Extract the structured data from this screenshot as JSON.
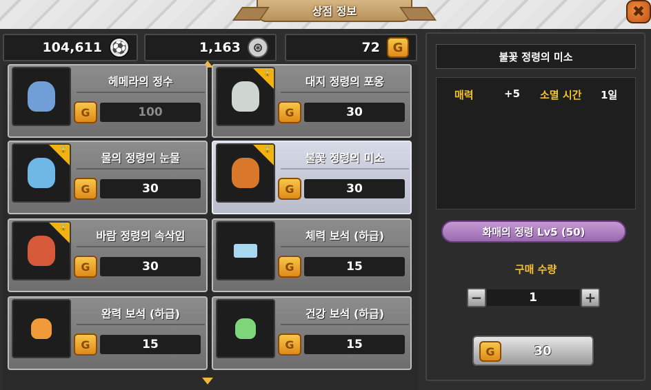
{
  "header": {
    "title": "상점 정보",
    "close_icon": "close-icon"
  },
  "currencies": [
    {
      "value": "104,611",
      "icon": "soccer-ball-icon"
    },
    {
      "value": "1,163",
      "icon": "compass-icon"
    },
    {
      "value": "72",
      "icon": "gold-coin-icon"
    }
  ],
  "items": [
    {
      "name": "헤메라의 정수",
      "price": "100",
      "locked": false,
      "art_color": "#6f9fd6",
      "price_dim": true
    },
    {
      "name": "대지 정령의 포옹",
      "price": "30",
      "locked": true,
      "art_color": "#cfd6cf",
      "price_dim": false
    },
    {
      "name": "물의 정령의 눈물",
      "price": "30",
      "locked": true,
      "art_color": "#6fb8e6",
      "price_dim": false
    },
    {
      "name": "불꽃 정령의 미소",
      "price": "30",
      "locked": true,
      "art_color": "#d9782a",
      "price_dim": false,
      "selected": true
    },
    {
      "name": "바람 정령의 속삭임",
      "price": "30",
      "locked": true,
      "art_color": "#d65a3a",
      "price_dim": false
    },
    {
      "name": "체력 보석 (하급)",
      "price": "15",
      "locked": false,
      "art_color": "#a8d8f0",
      "price_dim": false
    },
    {
      "name": "완력 보석 (하급)",
      "price": "15",
      "locked": false,
      "art_color": "#f09a3a",
      "price_dim": false
    },
    {
      "name": "건강 보석 (하급)",
      "price": "15",
      "locked": false,
      "art_color": "#7ed67a",
      "price_dim": false
    }
  ],
  "detail": {
    "title": "불꽃 정령의 미소",
    "stat_name": "매력",
    "stat_value": "+5",
    "expire_label": "소멸 시간",
    "expire_value": "1일",
    "requirement": "화매의 정령 Lv5 (50)",
    "qty_label": "구매 수량",
    "qty_value": "1",
    "buy_price": "30"
  },
  "colors": {
    "accent_gold": "#f4c22c",
    "requirement_purple": "#9b6ab0",
    "lock_yellow": "#f2b20f"
  }
}
